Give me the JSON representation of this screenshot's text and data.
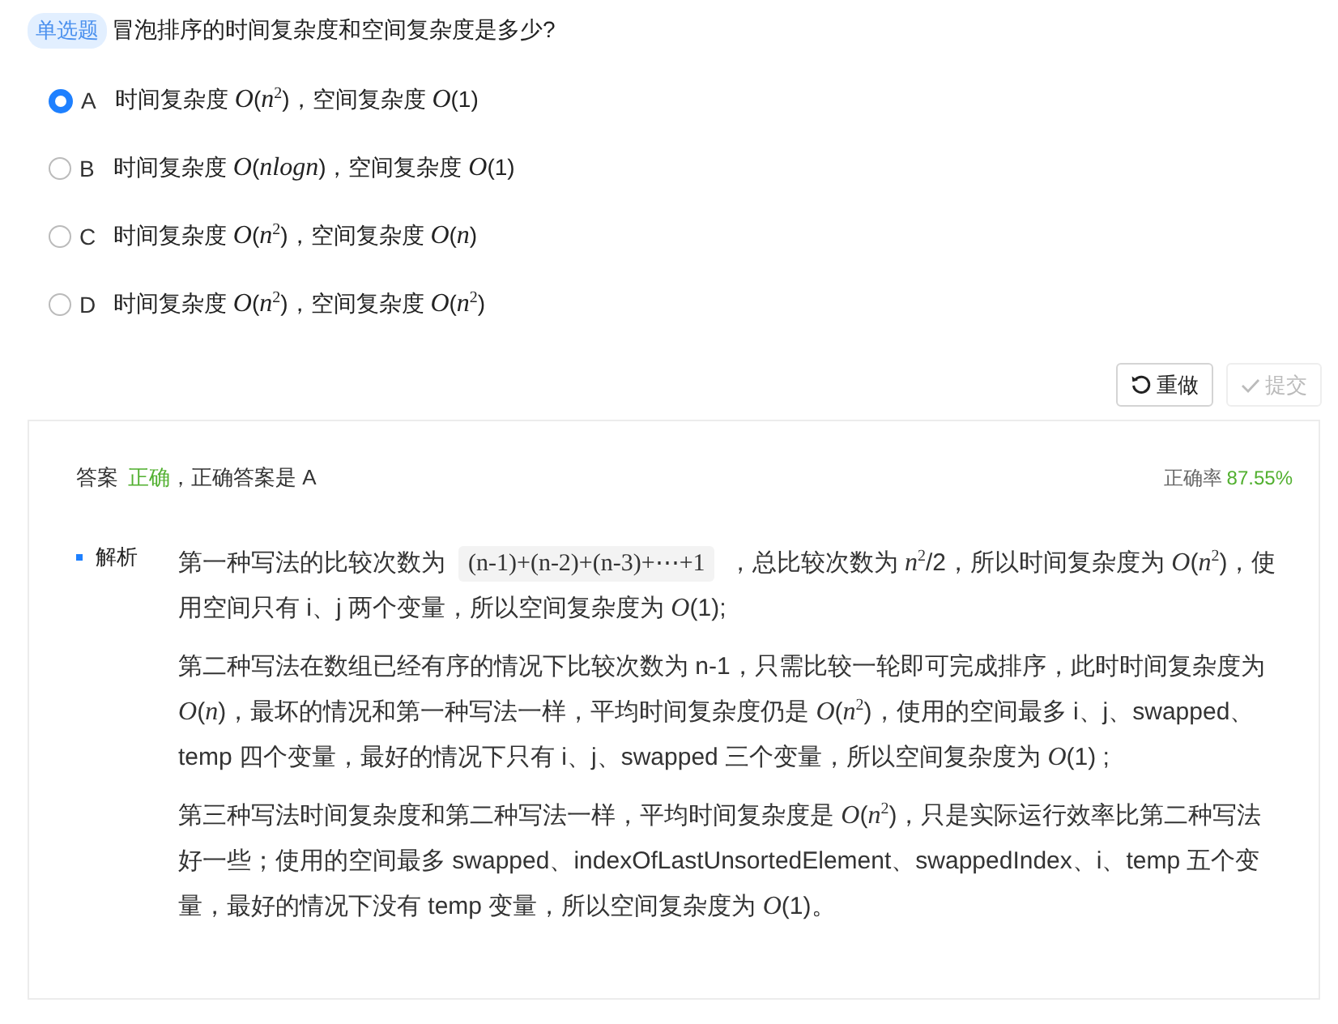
{
  "question": {
    "tag": "单选题",
    "text": "冒泡排序的时间复杂度和空间复杂度是多少?"
  },
  "options": [
    {
      "letter": "A",
      "text": "时间复杂度 *O*(*n*$^{2}$)，空间复杂度 *O*(1)",
      "selected": true
    },
    {
      "letter": "B",
      "text": "时间复杂度 *O*(*nlogn*)，空间复杂度 *O*(1)",
      "selected": false
    },
    {
      "letter": "C",
      "text": "时间复杂度 *O*(*n*$^{2}$)，空间复杂度 *O*(*n*)",
      "selected": false
    },
    {
      "letter": "D",
      "text": "时间复杂度 *O*(*n*$^{2}$)，空间复杂度 *O*(*n*$^{2}$)",
      "selected": false
    }
  ],
  "buttons": [
    {
      "kind": "redo",
      "label": "重做",
      "disabled": false
    },
    {
      "kind": "submit",
      "label": "提交",
      "disabled": true
    }
  ],
  "result": {
    "label": "答案",
    "verdict": "正确",
    "detail": "，正确答案是 A",
    "accuracy_label": "正确率",
    "accuracy": "87.55%"
  },
  "analysis": {
    "label": "解析",
    "paragraphs": [
      [
        {
          "kind": "text",
          "text": "第一种写法的比较次数为"
        },
        {
          "kind": "code",
          "text": "(n-1)+(n-2)+(n-3)+⋯+1"
        },
        {
          "kind": "text",
          "text": "，总比较次数为 *n*$^{2}$/2，所以时间复杂度为 *O*(*n*$^{2}$)，使用空间只有 i、j 两个变量，所以空间复杂度为 *O*(1);"
        }
      ],
      [
        {
          "kind": "text",
          "text": "第二种写法在数组已经有序的情况下比较次数为 n-1，只需比较一轮即可完成排序，此时时间复杂度为 *O*(*n*)，最坏的情况和第一种写法一样，平均时间复杂度仍是 *O*(*n*$^{2}$)，使用的空间最多 i、j、swapped、temp 四个变量，最好的情况下只有 i、j、swapped 三个变量，所以空间复杂度为 *O*(1) ;"
        }
      ],
      [
        {
          "kind": "text",
          "text": "第三种写法时间复杂度和第二种写法一样，平均时间复杂度是 *O*(*n*$^{2}$)，只是实际运行效率比第二种写法好一些；使用的空间最多 swapped、indexOfLastUnsortedElement、swappedIndex、i、temp 五个变量，最好的情况下没有 temp 变量，所以空间复杂度为 *O*(1)。"
        }
      ]
    ]
  }
}
